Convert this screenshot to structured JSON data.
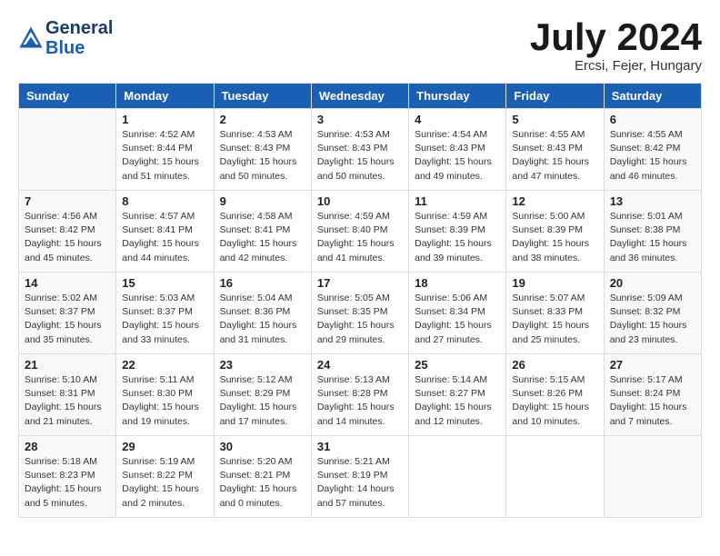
{
  "header": {
    "logo_line1": "General",
    "logo_line2": "Blue",
    "month_year": "July 2024",
    "location": "Ercsi, Fejer, Hungary"
  },
  "days_of_week": [
    "Sunday",
    "Monday",
    "Tuesday",
    "Wednesday",
    "Thursday",
    "Friday",
    "Saturday"
  ],
  "weeks": [
    [
      {
        "day": "",
        "info": ""
      },
      {
        "day": "1",
        "info": "Sunrise: 4:52 AM\nSunset: 8:44 PM\nDaylight: 15 hours\nand 51 minutes."
      },
      {
        "day": "2",
        "info": "Sunrise: 4:53 AM\nSunset: 8:43 PM\nDaylight: 15 hours\nand 50 minutes."
      },
      {
        "day": "3",
        "info": "Sunrise: 4:53 AM\nSunset: 8:43 PM\nDaylight: 15 hours\nand 50 minutes."
      },
      {
        "day": "4",
        "info": "Sunrise: 4:54 AM\nSunset: 8:43 PM\nDaylight: 15 hours\nand 49 minutes."
      },
      {
        "day": "5",
        "info": "Sunrise: 4:55 AM\nSunset: 8:43 PM\nDaylight: 15 hours\nand 47 minutes."
      },
      {
        "day": "6",
        "info": "Sunrise: 4:55 AM\nSunset: 8:42 PM\nDaylight: 15 hours\nand 46 minutes."
      }
    ],
    [
      {
        "day": "7",
        "info": "Sunrise: 4:56 AM\nSunset: 8:42 PM\nDaylight: 15 hours\nand 45 minutes."
      },
      {
        "day": "8",
        "info": "Sunrise: 4:57 AM\nSunset: 8:41 PM\nDaylight: 15 hours\nand 44 minutes."
      },
      {
        "day": "9",
        "info": "Sunrise: 4:58 AM\nSunset: 8:41 PM\nDaylight: 15 hours\nand 42 minutes."
      },
      {
        "day": "10",
        "info": "Sunrise: 4:59 AM\nSunset: 8:40 PM\nDaylight: 15 hours\nand 41 minutes."
      },
      {
        "day": "11",
        "info": "Sunrise: 4:59 AM\nSunset: 8:39 PM\nDaylight: 15 hours\nand 39 minutes."
      },
      {
        "day": "12",
        "info": "Sunrise: 5:00 AM\nSunset: 8:39 PM\nDaylight: 15 hours\nand 38 minutes."
      },
      {
        "day": "13",
        "info": "Sunrise: 5:01 AM\nSunset: 8:38 PM\nDaylight: 15 hours\nand 36 minutes."
      }
    ],
    [
      {
        "day": "14",
        "info": "Sunrise: 5:02 AM\nSunset: 8:37 PM\nDaylight: 15 hours\nand 35 minutes."
      },
      {
        "day": "15",
        "info": "Sunrise: 5:03 AM\nSunset: 8:37 PM\nDaylight: 15 hours\nand 33 minutes."
      },
      {
        "day": "16",
        "info": "Sunrise: 5:04 AM\nSunset: 8:36 PM\nDaylight: 15 hours\nand 31 minutes."
      },
      {
        "day": "17",
        "info": "Sunrise: 5:05 AM\nSunset: 8:35 PM\nDaylight: 15 hours\nand 29 minutes."
      },
      {
        "day": "18",
        "info": "Sunrise: 5:06 AM\nSunset: 8:34 PM\nDaylight: 15 hours\nand 27 minutes."
      },
      {
        "day": "19",
        "info": "Sunrise: 5:07 AM\nSunset: 8:33 PM\nDaylight: 15 hours\nand 25 minutes."
      },
      {
        "day": "20",
        "info": "Sunrise: 5:09 AM\nSunset: 8:32 PM\nDaylight: 15 hours\nand 23 minutes."
      }
    ],
    [
      {
        "day": "21",
        "info": "Sunrise: 5:10 AM\nSunset: 8:31 PM\nDaylight: 15 hours\nand 21 minutes."
      },
      {
        "day": "22",
        "info": "Sunrise: 5:11 AM\nSunset: 8:30 PM\nDaylight: 15 hours\nand 19 minutes."
      },
      {
        "day": "23",
        "info": "Sunrise: 5:12 AM\nSunset: 8:29 PM\nDaylight: 15 hours\nand 17 minutes."
      },
      {
        "day": "24",
        "info": "Sunrise: 5:13 AM\nSunset: 8:28 PM\nDaylight: 15 hours\nand 14 minutes."
      },
      {
        "day": "25",
        "info": "Sunrise: 5:14 AM\nSunset: 8:27 PM\nDaylight: 15 hours\nand 12 minutes."
      },
      {
        "day": "26",
        "info": "Sunrise: 5:15 AM\nSunset: 8:26 PM\nDaylight: 15 hours\nand 10 minutes."
      },
      {
        "day": "27",
        "info": "Sunrise: 5:17 AM\nSunset: 8:24 PM\nDaylight: 15 hours\nand 7 minutes."
      }
    ],
    [
      {
        "day": "28",
        "info": "Sunrise: 5:18 AM\nSunset: 8:23 PM\nDaylight: 15 hours\nand 5 minutes."
      },
      {
        "day": "29",
        "info": "Sunrise: 5:19 AM\nSunset: 8:22 PM\nDaylight: 15 hours\nand 2 minutes."
      },
      {
        "day": "30",
        "info": "Sunrise: 5:20 AM\nSunset: 8:21 PM\nDaylight: 15 hours\nand 0 minutes."
      },
      {
        "day": "31",
        "info": "Sunrise: 5:21 AM\nSunset: 8:19 PM\nDaylight: 14 hours\nand 57 minutes."
      },
      {
        "day": "",
        "info": ""
      },
      {
        "day": "",
        "info": ""
      },
      {
        "day": "",
        "info": ""
      }
    ]
  ]
}
